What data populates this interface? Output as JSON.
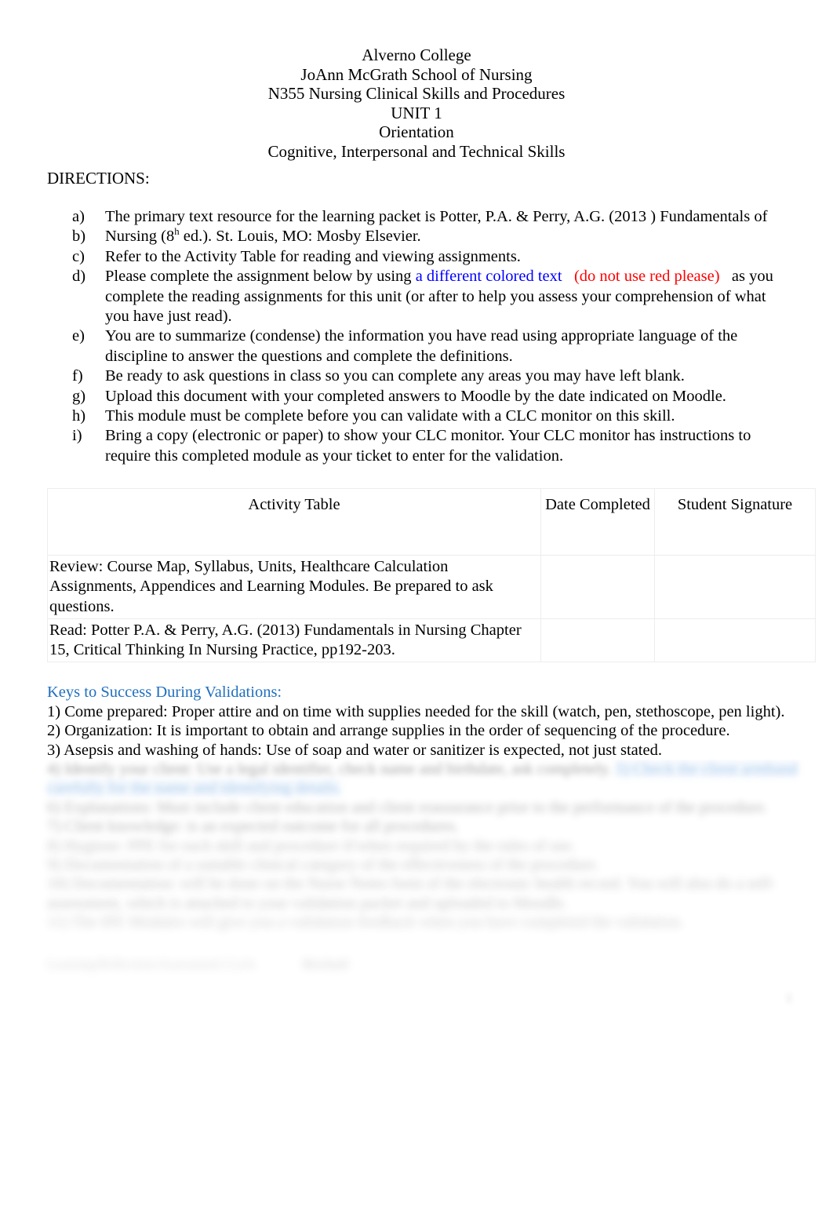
{
  "header": {
    "lines": [
      "Alverno College",
      "JoAnn McGrath School of Nursing",
      "N355 Nursing Clinical Skills and Procedures",
      "UNIT 1",
      "Orientation",
      "Cognitive, Interpersonal and Technical Skills"
    ]
  },
  "directions": {
    "label": "DIRECTIONS:",
    "items": [
      {
        "marker": "a)",
        "text": "The primary text resource for the learning packet is Potter, P.A. & Perry, A.G. (2013 ) Fundamentals of"
      },
      {
        "marker": "b)",
        "text_before": "Nursing (8",
        "superscript": "h",
        "text_after": " ed.).  St. Louis, MO: Mosby Elsevier."
      },
      {
        "marker": "c)",
        "text": "Refer to the Activity Table for reading and viewing assignments."
      },
      {
        "marker": "d)",
        "text_before": "Please complete the assignment below by using ",
        "blue_text": "a different colored text",
        "red_text": "(do not use red please)",
        "text_after": "as you complete the reading assignments for this unit (or after to help you assess your comprehension of what you have just read)."
      },
      {
        "marker": "e)",
        "text": "You are to summarize (condense) the information you have read using appropriate language of the discipline to answer the questions and complete the definitions."
      },
      {
        "marker": "f)",
        "text": "Be ready to ask questions in class so you can complete any areas you may have left blank."
      },
      {
        "marker": "g)",
        "text": "Upload this document with your completed answers to Moodle by the date indicated on Moodle."
      },
      {
        "marker": "h)",
        "text": "This module must be complete before you can validate with a CLC monitor on this skill."
      },
      {
        "marker": "i)",
        "text": "Bring a copy (electronic or paper) to show your CLC monitor. Your CLC monitor has instructions to require this completed module as your ticket to enter for the validation."
      }
    ]
  },
  "activity_table": {
    "headers": {
      "activity": "Activity Table",
      "date_completed": "Date Completed",
      "student_signature": "Student Signature"
    },
    "rows": [
      {
        "activity": "Review:  Course Map, Syllabus, Units, Healthcare Calculation Assignments, Appendices and Learning Modules.   Be prepared to ask questions.",
        "date_completed": "",
        "student_signature": ""
      },
      {
        "activity": "Read:   Potter P.A. & Perry, A.G. (2013)  Fundamentals in Nursing Chapter 15, Critical Thinking In Nursing Practice, pp192-203.",
        "date_completed": "",
        "student_signature": ""
      }
    ]
  },
  "keys_to_success": {
    "heading": "Keys to Success During Validations:",
    "items": [
      "1) Come prepared:     Proper attire and on time with supplies needed for the skill (watch, pen, stethoscope, pen light).",
      "2) Organization:    It is important to obtain and arrange supplies in the order of sequencing of the procedure.",
      "3) Asepsis and washing of hands:     Use of soap and water or sanitizer is expected, not just stated."
    ]
  },
  "obscured_tail": {
    "note": "Remaining lines are blurred beyond legibility in the source image.",
    "lines": [
      "4) Identify your client:     Use a legal identifier, check name and birthdate, ask completely.",
      "5) Check the client armband carefully for the name and identifying details.",
      "6) Explanations:     Must include client education and client reassurance     prior to the performance of the procedure.",
      "7) Client knowledge:   is an expected outcome for all procedures.",
      "8) Hygiene:    PPE for each skill and procedure if/when required by the rules of use.",
      "9) Documentation of a suitable clinical category of the effectiveness of the procedure.",
      "10) Documentation:    will be done on the Nurse Notes form of the electronic health record. You will also do a self-assessment, which is attached to your validation packet and uploaded to Moodle.",
      "11) The IPE Modules will give you a validation feedback when you have completed the validation."
    ],
    "footer_left": "Learning/Reflection/Assessment Cycle",
    "footer_right": "Revised",
    "page_number": "1"
  }
}
